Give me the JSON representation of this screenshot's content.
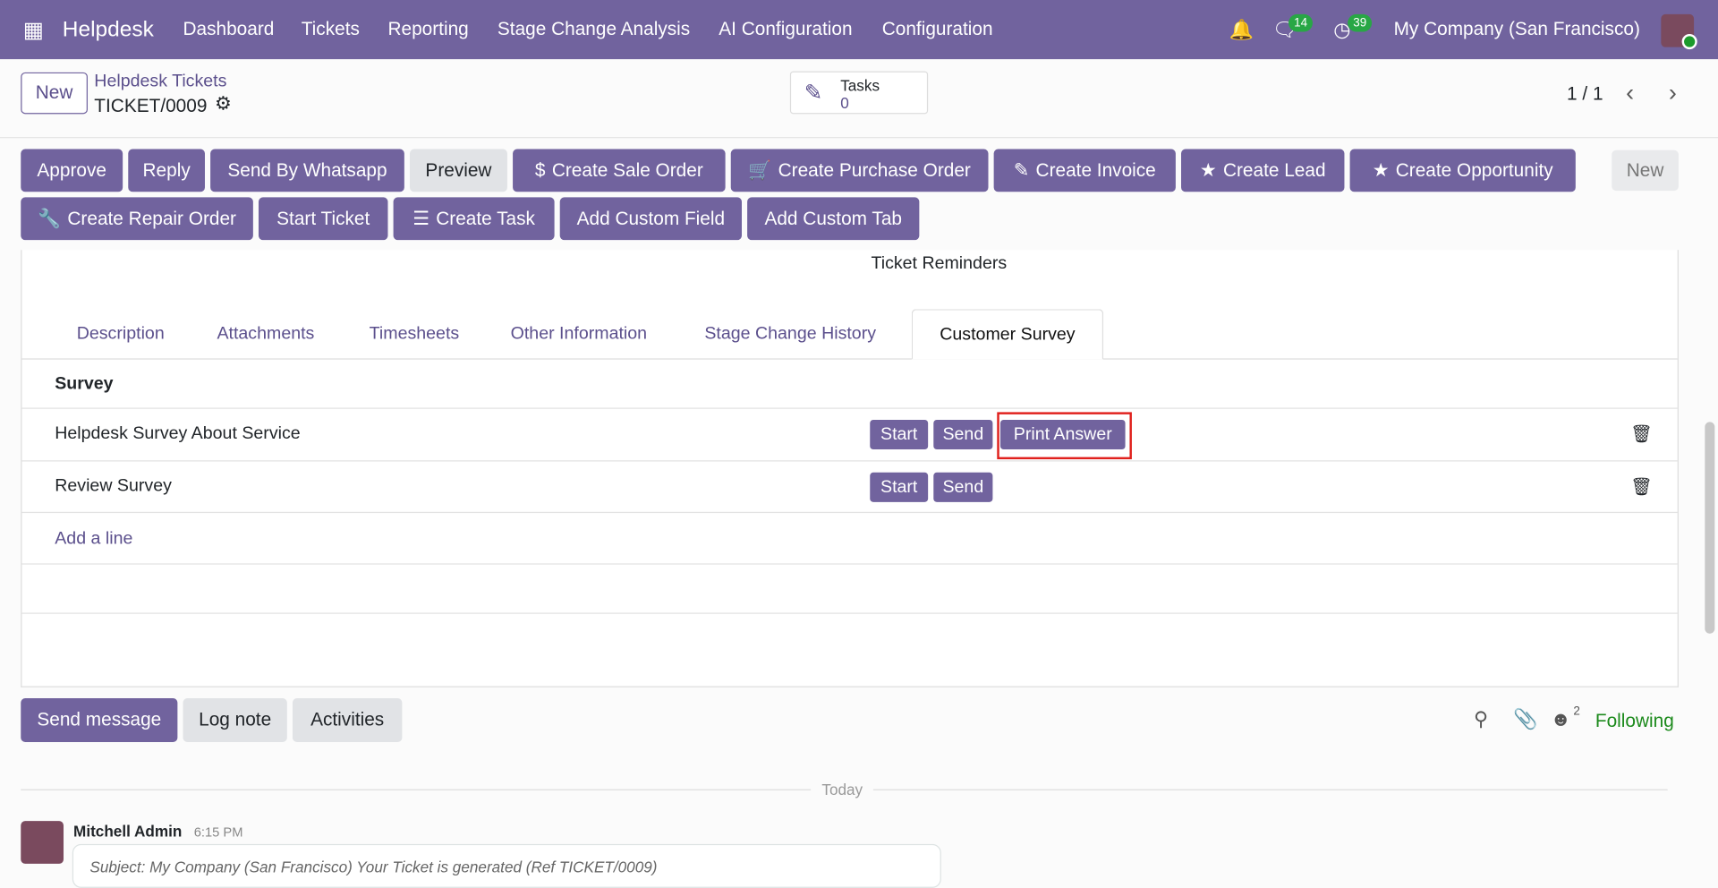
{
  "navbar": {
    "app": "Helpdesk",
    "menu": [
      "Dashboard",
      "Tickets",
      "Reporting",
      "Stage Change Analysis",
      "AI Configuration",
      "Configuration"
    ],
    "messages_count": "14",
    "activities_count": "39",
    "company": "My Company (San Francisco)"
  },
  "control": {
    "new_label": "New",
    "breadcrumb": "Helpdesk Tickets",
    "record": "TICKET/0009",
    "tasks_label": "Tasks",
    "tasks_count": "0",
    "pager": "1 / 1"
  },
  "actions": {
    "row1": [
      "Approve",
      "Reply",
      "Send By Whatsapp",
      "Preview",
      "Create Sale Order",
      "Create Purchase Order",
      "Create Invoice",
      "Create Lead",
      "Create Opportunity"
    ],
    "row2": [
      "Create Repair Order",
      "Start Ticket",
      "Create Task",
      "Add Custom Field",
      "Add Custom Tab"
    ],
    "status_new": "New"
  },
  "sheet": {
    "reminders": "Ticket Reminders",
    "tabs": [
      "Description",
      "Attachments",
      "Timesheets",
      "Other Information",
      "Stage Change History",
      "Customer Survey"
    ],
    "active_tab": "Customer Survey",
    "column": "Survey",
    "rows": [
      {
        "name": "Helpdesk Survey About Service",
        "buttons": [
          "Start",
          "Send",
          "Print Answer"
        ]
      },
      {
        "name": "Review Survey",
        "buttons": [
          "Start",
          "Send"
        ]
      }
    ],
    "add_line": "Add a line"
  },
  "chatter": {
    "send": "Send message",
    "log": "Log note",
    "activities": "Activities",
    "followers": "2",
    "following": "Following",
    "date_sep": "Today",
    "author": "Mitchell Admin",
    "time": "6:15 PM",
    "subject": "Subject: My Company (San Francisco) Your Ticket is generated (Ref TICKET/0009)"
  },
  "colors": {
    "brand": "#71639e",
    "highlight": "#e0201c",
    "following": "#1c8a1c"
  }
}
